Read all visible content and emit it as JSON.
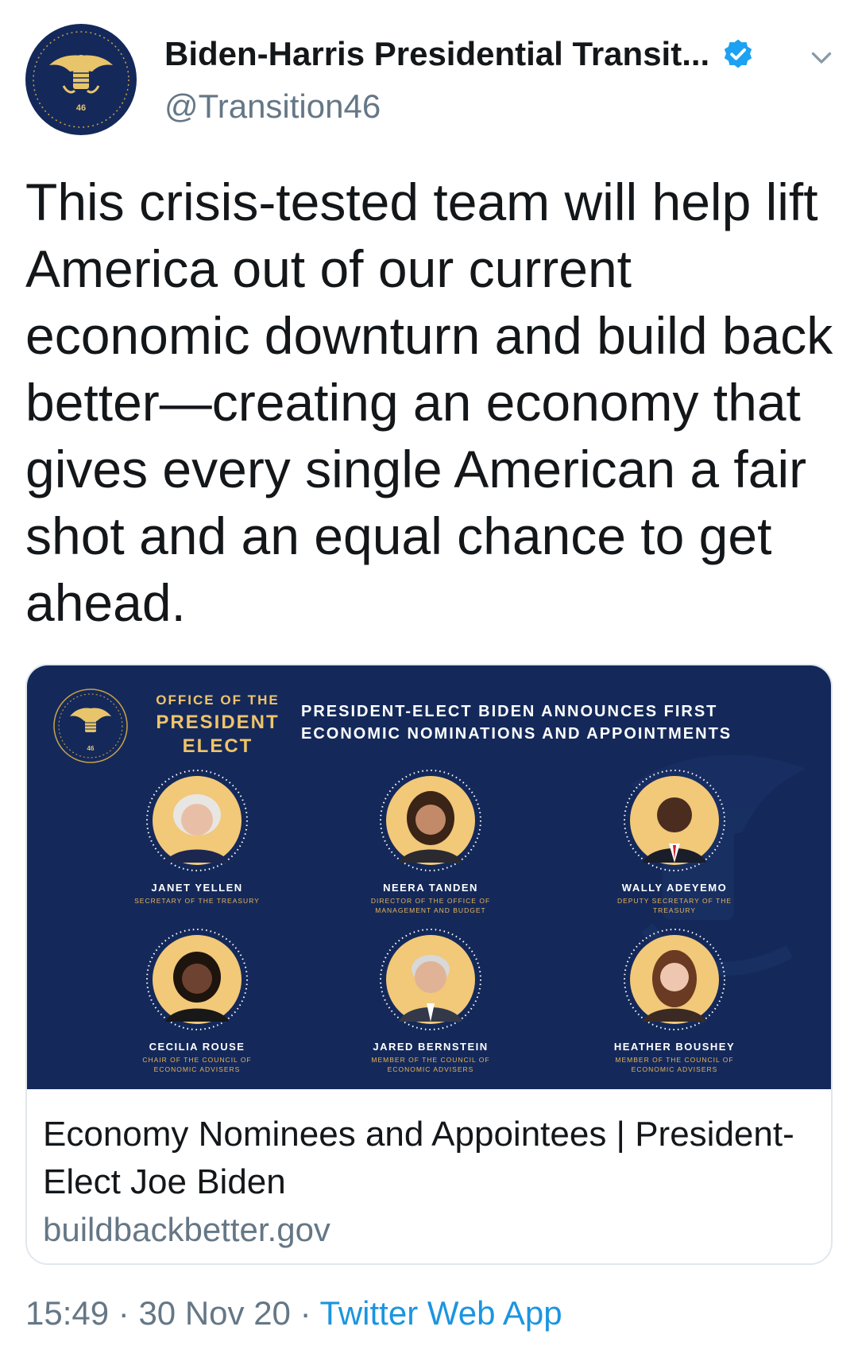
{
  "account": {
    "display_name": "Biden-Harris Presidential Transit...",
    "handle": "@Transition46",
    "avatar_number": "46"
  },
  "tweet": {
    "text": "This crisis-tested team will help lift America out of our current economic downturn and build back better—creating an economy that gives every single American a fair shot and an equal chance to get ahead."
  },
  "card": {
    "image": {
      "office_line1": "OFFICE OF THE",
      "office_line2": "PRESIDENT",
      "office_line3": "ELECT",
      "seal_number": "46",
      "headline": "PRESIDENT-ELECT BIDEN ANNOUNCES FIRST ECONOMIC NOMINATIONS AND APPOINTMENTS",
      "people": [
        {
          "name": "JANET YELLEN",
          "role": "SECRETARY OF THE TREASURY"
        },
        {
          "name": "NEERA TANDEN",
          "role": "DIRECTOR OF THE OFFICE OF MANAGEMENT AND BUDGET"
        },
        {
          "name": "WALLY ADEYEMO",
          "role": "DEPUTY SECRETARY OF THE TREASURY"
        },
        {
          "name": "CECILIA ROUSE",
          "role": "CHAIR OF THE COUNCIL OF ECONOMIC ADVISERS"
        },
        {
          "name": "JARED BERNSTEIN",
          "role": "MEMBER OF THE COUNCIL OF ECONOMIC ADVISERS"
        },
        {
          "name": "HEATHER BOUSHEY",
          "role": "MEMBER OF THE COUNCIL OF ECONOMIC ADVISERS"
        }
      ]
    },
    "title": "Economy Nominees and Appointees | President-Elect Joe Biden",
    "domain": "buildbackbetter.gov"
  },
  "meta": {
    "time": "15:49",
    "separator": "·",
    "date": "30 Nov 20",
    "source": "Twitter Web App"
  },
  "colors": {
    "navy": "#14295a",
    "gold": "#f0c46a",
    "link": "#1b95e0",
    "verified": "#1da1f2"
  }
}
